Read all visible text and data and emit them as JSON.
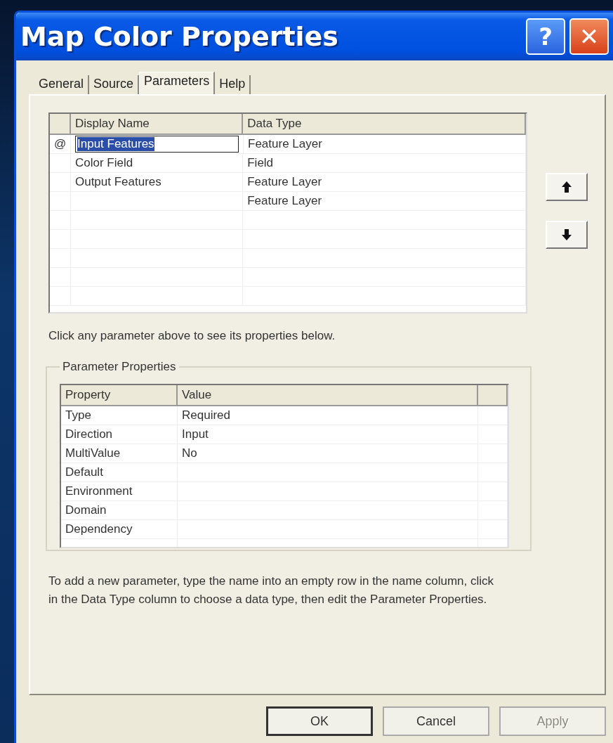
{
  "window": {
    "title": "Map Color Properties",
    "help_button": "?",
    "close_button": "✕"
  },
  "tabs": [
    {
      "label": "General",
      "selected": false
    },
    {
      "label": "Source",
      "selected": false
    },
    {
      "label": "Parameters",
      "selected": true
    },
    {
      "label": "Help",
      "selected": false
    }
  ],
  "parameters": {
    "columns": [
      "Display Name",
      "Data Type"
    ],
    "rows": [
      {
        "marker": "@",
        "display_name": "Input Features",
        "data_type": "Feature Layer",
        "selected": true
      },
      {
        "display_name": "Color Field",
        "data_type": "Field",
        "selected": false
      },
      {
        "display_name": "Output Features",
        "data_type": "Feature Layer",
        "selected": false
      },
      {
        "data_type": "Feature Layer",
        "selected": false
      }
    ]
  },
  "move_buttons": [
    {
      "kind": "up"
    },
    {
      "kind": "down"
    }
  ],
  "hint": "Click any parameter above to see its properties below.",
  "parameter_properties": {
    "title": "Parameter Properties",
    "columns": [
      "Property",
      "Value"
    ],
    "rows": [
      {
        "property": "Type",
        "value": "Required"
      },
      {
        "property": "Direction",
        "value": "Input"
      },
      {
        "property": "MultiValue",
        "value": "No"
      },
      {
        "property": "Default"
      },
      {
        "property": "Environment"
      },
      {
        "property": "Domain"
      },
      {
        "property": "Dependency"
      }
    ]
  },
  "instructions": "To add a new parameter, type the name into an empty row in the name column, click in the Data Type column to choose a data type, then edit the Parameter Properties.",
  "buttons": [
    {
      "label": "OK",
      "default": true,
      "disabled": false
    },
    {
      "label": "Cancel",
      "default": false,
      "disabled": false
    },
    {
      "label": "Apply",
      "default": false,
      "disabled": true
    }
  ]
}
